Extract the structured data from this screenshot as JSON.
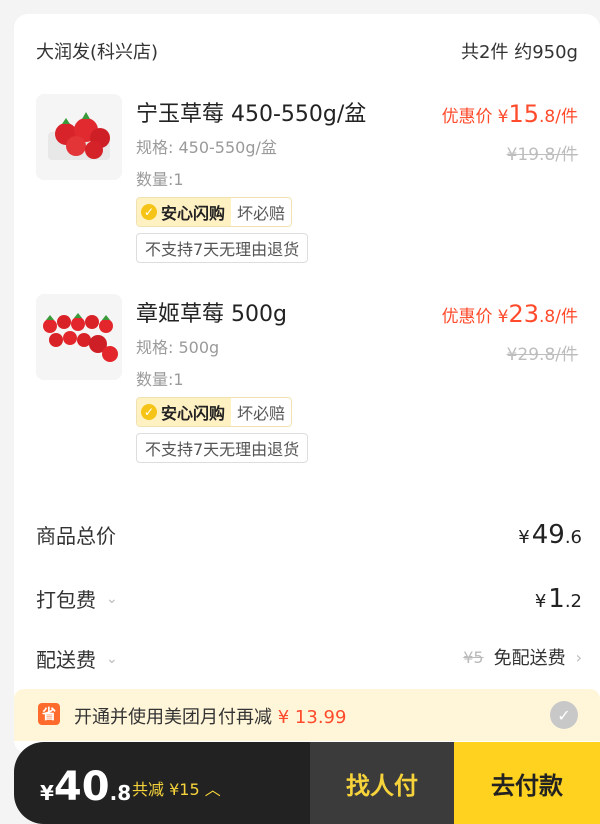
{
  "store": {
    "name": "大润发(科兴店)",
    "summary": "共2件 约950g"
  },
  "items": [
    {
      "name": "宁玉草莓 450-550g/盆",
      "spec": "规格: 450-550g/盆",
      "qty": "数量:1",
      "price_label": "优惠价",
      "currency": "¥",
      "price_int": "15",
      "price_dec": ".8",
      "price_unit": "/件",
      "original_price": "¥19.8/件",
      "tag_main": "安心闪购",
      "tag_sub": "坏必赔",
      "return_note": "不支持7天无理由退货"
    },
    {
      "name": "章姬草莓 500g",
      "spec": "规格: 500g",
      "qty": "数量:1",
      "price_label": "优惠价",
      "currency": "¥",
      "price_int": "23",
      "price_dec": ".8",
      "price_unit": "/件",
      "original_price": "¥29.8/件",
      "tag_main": "安心闪购",
      "tag_sub": "坏必赔",
      "return_note": "不支持7天无理由退货"
    }
  ],
  "summary": {
    "goods_total_label": "商品总价",
    "goods_total_yen": "¥",
    "goods_total_int": "49",
    "goods_total_frac": ".6",
    "packing_label": "打包费",
    "packing_yen": "¥",
    "packing_int": "1",
    "packing_frac": ".2",
    "delivery_label": "配送费",
    "delivery_original": "¥5",
    "delivery_value": "免配送费"
  },
  "promo": {
    "icon_text": "省",
    "text": "开通并使用美团月付再减",
    "amount": "¥ 13.99"
  },
  "bottom": {
    "yen": "¥",
    "total_int": "40",
    "total_frac": ".8",
    "saved": "共减 ¥15",
    "friend_pay": "找人付",
    "pay": "去付款"
  },
  "colors": {
    "accent_red": "#ff4b2b",
    "accent_yellow": "#ffd21f",
    "dark_bar": "#222222"
  },
  "icons": [
    "strawberry-thumbnail",
    "check-badge-icon",
    "chevron-down-icon",
    "chevron-right-icon",
    "saving-icon",
    "check-circle-icon",
    "chevron-up-icon"
  ]
}
